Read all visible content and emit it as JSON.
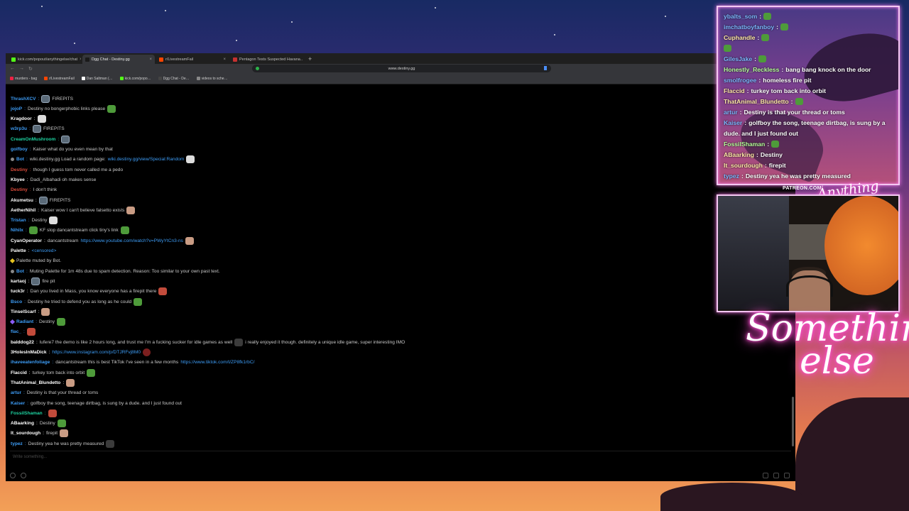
{
  "browser": {
    "tabs": [
      {
        "label": "kick.com/popout/anythingelse/chat",
        "color": "#53fc18"
      },
      {
        "label": "Dgg Chat - Destiny.gg",
        "color": "#1a1a1a",
        "active": true
      },
      {
        "label": "r/LivestreamFail",
        "color": "#ff4500"
      },
      {
        "label": "Pentagon Tests Suspected Havana…",
        "color": "#c53030"
      }
    ],
    "new_tab": "+",
    "url": "www.destiny.gg",
    "bookmarks": [
      {
        "label": "murders - bag",
        "color": "#e24"
      },
      {
        "label": "r/LivestreamFail",
        "color": "#ff4500"
      },
      {
        "label": "Dan Saltman (…",
        "color": "#fff"
      },
      {
        "label": "kick.com/popo…",
        "color": "#53fc18"
      },
      {
        "label": "Dgg Chat - De…",
        "color": "#444"
      },
      {
        "label": "videos to sche…",
        "color": "#888"
      }
    ]
  },
  "chat": {
    "messages": [
      {
        "user": "ThrashXCV",
        "ucolor": "#3d9cf5",
        "text": "FIREPITS",
        "emote": "gray"
      },
      {
        "user": "jojoP",
        "ucolor": "#3d9cf5",
        "text": "Destiny no bongerphobic links please",
        "emote_after": "pepe"
      },
      {
        "user": "Kragdoor",
        "ucolor": "#ffffff",
        "text": "",
        "emote": "white"
      },
      {
        "user": "w3rp3u",
        "ucolor": "#3d9cf5",
        "text": "FIREPITS",
        "emote": "gray"
      },
      {
        "user": "CreamOnMushroom",
        "ucolor": "#1dd3a1",
        "text": "",
        "emote": "gray"
      },
      {
        "user": "golfboy",
        "ucolor": "#3d9cf5",
        "text": "Kaiser what do you even mean by that"
      },
      {
        "user": "Bot",
        "ucolor": "#3d9cf5",
        "text": "wiki.destiny.gg Load a random page:",
        "link": "wiki.destiny.gg/view/Special:Random",
        "emote_after": "white",
        "bot": true
      },
      {
        "user": "Destiny",
        "ucolor": "#d84a3a",
        "text": "though I guess tom never called me a pedo"
      },
      {
        "user": "Kbyee",
        "ucolor": "#ffffff",
        "text": "Dadi_Albahadi oh makes sense"
      },
      {
        "user": "Destiny",
        "ucolor": "#d84a3a",
        "text": "I don't think"
      },
      {
        "user": "Akumetsu",
        "ucolor": "#ffffff",
        "text": "FIREPITS",
        "emote": "gray"
      },
      {
        "user": "AetherNihil",
        "ucolor": "#ffffff",
        "text": "Kaiser wow I can't believe falsetto exists",
        "emote_after": "face"
      },
      {
        "user": "Tristan",
        "ucolor": "#3d9cf5",
        "text": "Destiny",
        "emote_after": "white"
      },
      {
        "user": "Nihilx",
        "ucolor": "#3d9cf5",
        "text": "KF slop dancantstream click tiny's link",
        "emote": "pepe",
        "emote_after": "pepe"
      },
      {
        "user": "CyanOperator",
        "ucolor": "#ffffff",
        "text": "dancantstream",
        "emote_after": "face",
        "link": "https://www.youtube.com/watch?v=PWyYtCn3-ns"
      },
      {
        "user": "Palette",
        "ucolor": "#ffffff",
        "text": "<censored>",
        "censored": true
      },
      {
        "user": "",
        "ucolor": "#ffffff",
        "text": "Palette muted by Bot.",
        "diamond": true
      },
      {
        "user": "Bot",
        "ucolor": "#3d9cf5",
        "text": "Muting Palette for 1m 48s due to spam detection. Reason: Too similar to your own past text.",
        "bot": true
      },
      {
        "user": "kartaoj",
        "ucolor": "#ffffff",
        "text": "fire pit",
        "emote": "gray"
      },
      {
        "user": "tuck3r",
        "ucolor": "#ffffff",
        "text": "Dan you lived in Mass, you know everyone has a firepit there",
        "emote_after": "red"
      },
      {
        "user": "Bsco",
        "ucolor": "#3d9cf5",
        "text": "Destiny he tried to defend you as long as he could",
        "emote_after": "pepe"
      },
      {
        "user": "TinselScarf",
        "ucolor": "#ffffff",
        "text": "",
        "emote": "face"
      },
      {
        "user": "Radiant",
        "ucolor": "#3d9cf5",
        "text": "Destiny",
        "emote_after": "pepe",
        "badge": true
      },
      {
        "user": "flac_",
        "ucolor": "#3d9cf5",
        "text": "",
        "emote": "red"
      },
      {
        "user": "balddog22",
        "ucolor": "#ffffff",
        "text": "lufere7 the demo is like 2 hours long, and trust me I'm a fucking sucker for idle games as well",
        "emote_after": "dark",
        "text2": "i really enjoyed it though. definitely a unique idle game, super interesting IMO"
      },
      {
        "user": "3HolesInMaDick",
        "ucolor": "#ffffff",
        "text": "",
        "link": "https://www.instagram.com/p/DTJRFvj8M0",
        "emote_after": "round"
      },
      {
        "user": "ihaveeatenfoliage",
        "ucolor": "#3d9cf5",
        "text": "dancantstream this is best TikTok I've seen in a few months",
        "link": "https://www.tiktok.com/t/ZP8fk1rbC/"
      },
      {
        "user": "Flaccid",
        "ucolor": "#ffffff",
        "text": "turkey tom back into orbit",
        "emote_after": "pepe"
      },
      {
        "user": "ThatAnimal_Blundetto",
        "ucolor": "#ffffff",
        "text": "",
        "emote_after": "face"
      },
      {
        "user": "artur",
        "ucolor": "#3d9cf5",
        "text": "Destiny is that your thread or toms"
      },
      {
        "user": "Kaiser",
        "ucolor": "#3d9cf5",
        "text": "golfboy the song, teenage dirtbag, is sung by a dude. and I just found out"
      },
      {
        "user": "FossilShaman",
        "ucolor": "#1dd3a1",
        "text": "",
        "emote_after": "red"
      },
      {
        "user": "ABaarking",
        "ucolor": "#ffffff",
        "text": "Destiny",
        "emote_after": "pepe"
      },
      {
        "user": "It_sourdough",
        "ucolor": "#ffffff",
        "text": "firepit",
        "emote_after": "face"
      },
      {
        "user": "typez",
        "ucolor": "#3d9cf5",
        "text": "Destiny yea he was pretty measured",
        "emote_after": "dark"
      }
    ],
    "input_placeholder": "Write something..."
  },
  "overlay": {
    "messages": [
      {
        "user": "ybaIts_som",
        "text": "",
        "ncolor": "blue"
      },
      {
        "user": "imchatboyfanboy",
        "text": "",
        "ncolor": "blue"
      },
      {
        "user": "Cuphandle",
        "text": "",
        "ncolor": "white"
      },
      {
        "user": "",
        "text": "",
        "ncolor": "white"
      },
      {
        "user": "GilesJake",
        "text": "",
        "ncolor": "blue"
      },
      {
        "user": "Honestly_Reckless",
        "text": "bang bang knock on the door",
        "ncolor": "green"
      },
      {
        "user": "smolfrogee",
        "text": "homeless fire pit",
        "ncolor": "blue"
      },
      {
        "user": "Flaccid",
        "text": "turkey tom back into orbit",
        "ncolor": "white"
      },
      {
        "user": "ThatAnimal_Blundetto",
        "text": "",
        "ncolor": "white"
      },
      {
        "user": "artur",
        "text": "Destiny is that your thread or toms",
        "ncolor": "blue"
      },
      {
        "user": "Kaiser",
        "text": "golfboy the song, teenage dirtbag, is sung by a",
        "ncolor": "blue"
      },
      {
        "user": "",
        "text": "dude. and I just found out",
        "ncolor": "white"
      },
      {
        "user": "FossilShaman",
        "text": "",
        "ncolor": "green"
      },
      {
        "user": "ABaarking",
        "text": "Destiny",
        "ncolor": "white"
      },
      {
        "user": "It_sourdough",
        "text": "firepit",
        "ncolor": "white"
      },
      {
        "user": "typez",
        "text": "Destiny yea he was pretty measured",
        "ncolor": "blue"
      }
    ],
    "patreon": "PATREON.COM/",
    "brand": "Anything else",
    "neon_line1": "Something",
    "neon_line2": "else"
  }
}
